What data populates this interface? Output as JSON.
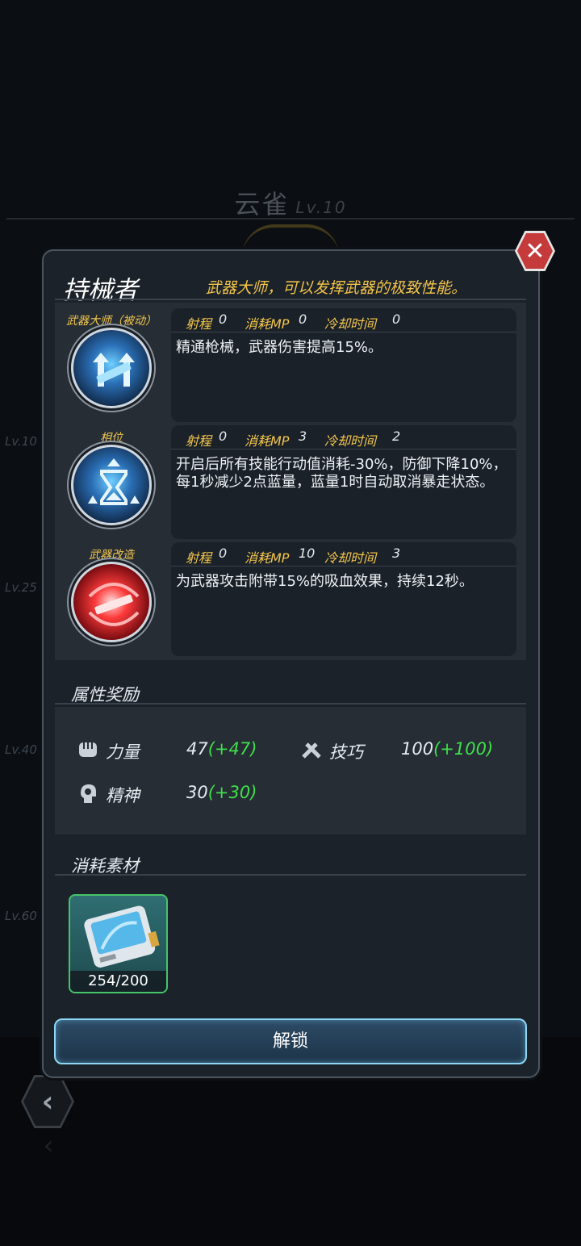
{
  "background": {
    "character_name": "云雀",
    "character_level": "Lv.10",
    "level_markers": [
      "Lv.10",
      "Lv.25",
      "Lv.40",
      "Lv.60"
    ],
    "back_icon": "chevron-left-icon"
  },
  "dialog": {
    "title": "持械者",
    "subtitle": "武器大师，可以发挥武器的极致性能。",
    "close_icon": "close-icon",
    "stat_labels": {
      "range": "射程",
      "mp_cost": "消耗MP",
      "cooldown": "冷却时间"
    },
    "skills": [
      {
        "name": "武器大师（被动）",
        "icon": "weapon-master-icon",
        "range": "0",
        "mp_cost": "0",
        "cooldown": "0",
        "description": "精通枪械，武器伤害提高15%。"
      },
      {
        "name": "相位",
        "icon": "hourglass-icon",
        "range": "0",
        "mp_cost": "3",
        "cooldown": "2",
        "description": "开启后所有技能行动值消耗-30%，防御下降10%，每1秒减少2点蓝量，蓝量1时自动取消暴走状态。"
      },
      {
        "name": "武器改造",
        "icon": "weapon-modify-icon",
        "range": "0",
        "mp_cost": "10",
        "cooldown": "3",
        "description": "为武器攻击附带15%的吸血效果，持续12秒。"
      }
    ],
    "attributes": {
      "label": "属性奖励",
      "items": [
        {
          "icon": "fist-icon",
          "name": "力量",
          "value": "47",
          "bonus": "(+47)"
        },
        {
          "icon": "tools-icon",
          "name": "技巧",
          "value": "100",
          "bonus": "(+100)"
        },
        {
          "icon": "mind-icon",
          "name": "精神",
          "value": "30",
          "bonus": "(+30)"
        }
      ]
    },
    "materials": {
      "label": "消耗素材",
      "items": [
        {
          "icon": "chip-card-icon",
          "count": "254/200"
        }
      ]
    },
    "unlock_label": "解锁"
  },
  "colors": {
    "accent_gold": "#f3c64c",
    "bonus_green": "#3fe04a",
    "close_red": "#c53a3a",
    "material_border": "#46c46a"
  }
}
